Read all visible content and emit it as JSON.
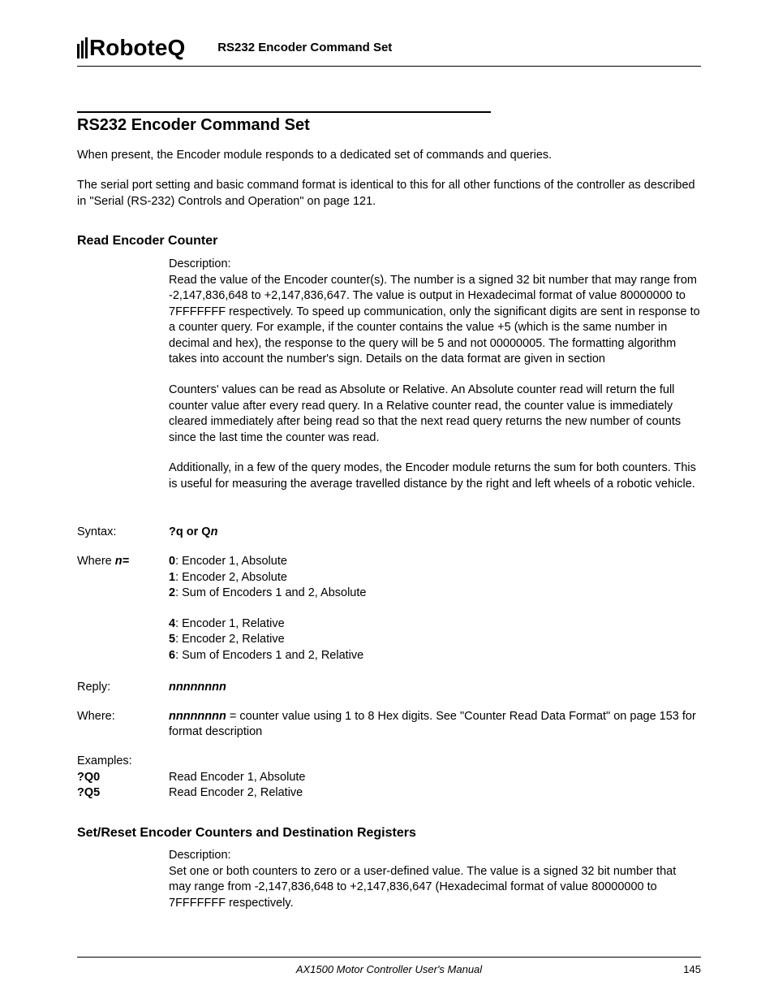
{
  "header": {
    "logo_text_part1": "Robote",
    "logo_text_part2": "Q",
    "page_header_title": "RS232 Encoder Command Set"
  },
  "section1": {
    "title": "RS232 Encoder Command Set",
    "p1": "When present, the Encoder module responds to a dedicated set of commands and queries.",
    "p2": "The serial port setting and basic command format is identical to this for all other functions of the controller as described in \"Serial (RS-232) Controls and Operation\" on page 121."
  },
  "section2": {
    "title": "Read Encoder Counter",
    "desc_label": "Description:",
    "desc_p1": "Read the value of the Encoder counter(s). The number is a signed 32 bit number that may range from -2,147,836,648 to +2,147,836,647. The value is output in Hexadecimal format of value 80000000 to 7FFFFFFF respectively. To speed up communication, only the significant digits are sent in response to a counter query. For example, if the counter contains the value +5 (which is the same number in decimal and hex), the response to the query will be 5 and not 00000005. The formatting algorithm takes into account the number's sign. Details on the data format are given in section",
    "desc_p2": "Counters' values can be read as Absolute or Relative. An Absolute counter read will return the full counter value after every read query. In a Relative counter read, the counter value is immediately cleared immediately after being read so that the next read query returns the new number of counts since the last time the counter was read.",
    "desc_p3": "Additionally, in a few of the query modes, the Encoder module returns the sum for both counters. This is useful for measuring the average travelled distance by the right and left wheels of a robotic vehicle.",
    "syntax_label": "Syntax:",
    "syntax_val_prefix": "?q or Q",
    "syntax_val_suffix": "n",
    "where_n_label_prefix": "Where ",
    "where_n_label_var": "n=",
    "wn0_k": "0",
    "wn0_v": ": Encoder 1, Absolute",
    "wn1_k": "1",
    "wn1_v": ": Encoder 2, Absolute",
    "wn2_k": "2",
    "wn2_v": ": Sum of Encoders 1 and 2, Absolute",
    "wn4_k": "4",
    "wn4_v": ": Encoder 1, Relative",
    "wn5_k": "5",
    "wn5_v": ": Encoder 2, Relative",
    "wn6_k": "6",
    "wn6_v": ": Sum of Encoders 1 and 2, Relative",
    "reply_label": "Reply:",
    "reply_val": "nnnnnnnn",
    "where_label": "Where:",
    "where_val_em": "nnnnnnnn",
    "where_val_rest": " = counter value using 1 to 8 Hex digits. See \"Counter Read Data Format\" on page 153 for format description",
    "examples_label": "Examples:",
    "ex1_cmd": "?Q0",
    "ex1_desc": "Read Encoder 1, Absolute",
    "ex2_cmd": "?Q5",
    "ex2_desc": "Read Encoder 2, Relative"
  },
  "section3": {
    "title": "Set/Reset Encoder Counters and Destination Registers",
    "desc_label": "Description:",
    "desc_p1": "Set one or both counters to zero or a user-defined value. The value is a signed 32 bit number that may range from -2,147,836,648 to +2,147,836,647 (Hexadecimal format of value 80000000 to 7FFFFFFF respectively."
  },
  "footer": {
    "manual_title": "AX1500 Motor Controller User's Manual",
    "page_number": "145"
  }
}
